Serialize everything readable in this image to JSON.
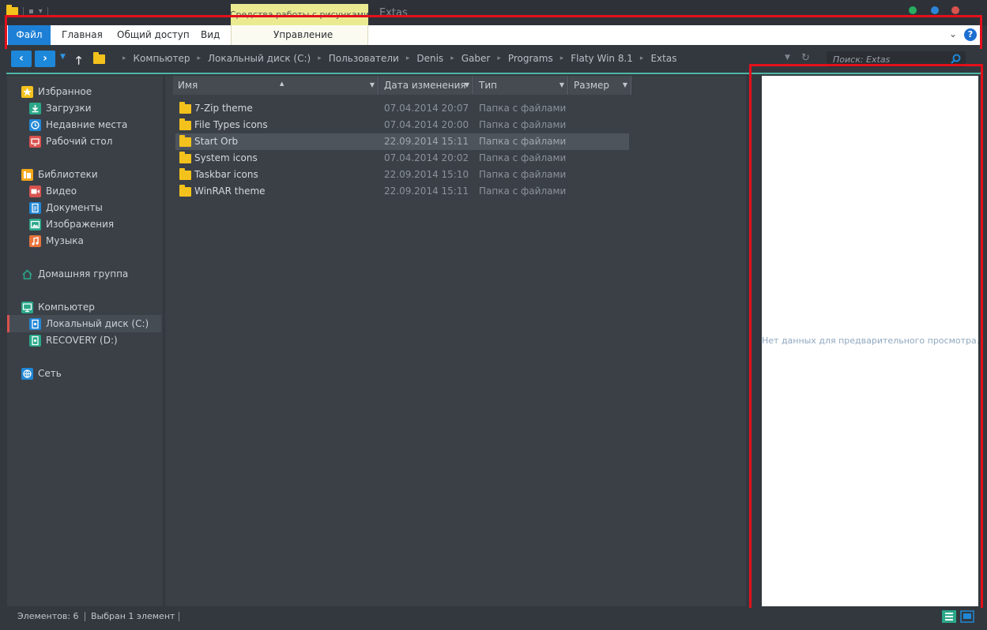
{
  "window": {
    "title": "Extas",
    "contextual_tab_group": "Средства работы с рисунками",
    "title_dots": [
      "#27ae60",
      "#2d86d6",
      "#d9534f"
    ]
  },
  "ribbon": {
    "tabs": [
      {
        "label": "Файл",
        "active": true
      },
      {
        "label": "Главная"
      },
      {
        "label": "Общий доступ"
      },
      {
        "label": "Вид"
      },
      {
        "label": "Управление"
      }
    ],
    "help_label": "?"
  },
  "address": {
    "breadcrumbs": [
      "Компьютер",
      "Локальный диск (C:)",
      "Пользователи",
      "Denis",
      "Gaber",
      "Programs",
      "Flaty Win 8.1",
      "Extas"
    ],
    "search_placeholder": "Поиск: Extas"
  },
  "navigation": {
    "favorites": {
      "label": "Избранное",
      "items": [
        "Загрузки",
        "Недавние места",
        "Рабочий стол"
      ]
    },
    "libraries": {
      "label": "Библиотеки",
      "items": [
        "Видео",
        "Документы",
        "Изображения",
        "Музыка"
      ]
    },
    "homegroup": {
      "label": "Домашняя группа"
    },
    "computer": {
      "label": "Компьютер",
      "items": [
        "Локальный диск (C:)",
        "RECOVERY (D:)"
      ],
      "selected": "Локальный диск (C:)"
    },
    "network": {
      "label": "Сеть"
    }
  },
  "columns": {
    "name": "Имя",
    "date": "Дата изменения",
    "type": "Тип",
    "size": "Размер"
  },
  "files": [
    {
      "name": "7-Zip theme",
      "date": "07.04.2014 20:07",
      "type": "Папка с файлами"
    },
    {
      "name": "File Types icons",
      "date": "07.04.2014 20:00",
      "type": "Папка с файлами"
    },
    {
      "name": "Start Orb",
      "date": "22.09.2014 15:11",
      "type": "Папка с файлами",
      "selected": true
    },
    {
      "name": "System icons",
      "date": "07.04.2014 20:02",
      "type": "Папка с файлами"
    },
    {
      "name": "Taskbar icons",
      "date": "22.09.2014 15:10",
      "type": "Папка с файлами"
    },
    {
      "name": "WinRAR theme",
      "date": "22.09.2014 15:11",
      "type": "Папка с файлами"
    }
  ],
  "preview": {
    "message": "Нет данных для предварительного просмотра."
  },
  "status": {
    "item_count": "Элементов: 6",
    "selected": "Выбран 1 элемент"
  },
  "colors": {
    "accent": "#1d87d9",
    "folder": "#f4c21c",
    "highlight_red": "#e4101c",
    "teal": "#4fb6a6"
  }
}
